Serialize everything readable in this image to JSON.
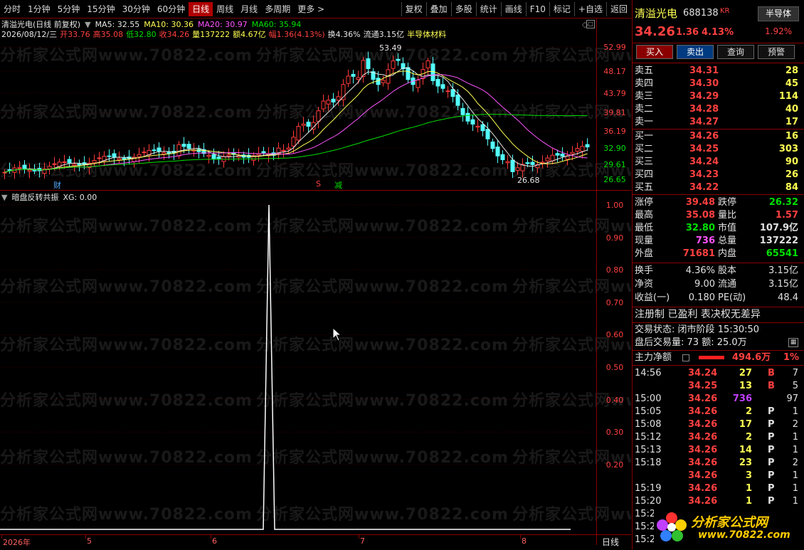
{
  "toolbar": {
    "periods": [
      "分时",
      "1分钟",
      "5分钟",
      "15分钟",
      "30分钟",
      "60分钟",
      "日线",
      "周线",
      "月线",
      "多周期",
      "更多 >"
    ],
    "active_period": "日线",
    "right_buttons": [
      "复权",
      "叠加",
      "多股",
      "统计",
      "画线",
      "F10",
      "标记",
      "+自选",
      "返回"
    ]
  },
  "chart_header": {
    "title": "清溢光电(日线 前复权)",
    "ma5": "MA5: 32.55",
    "ma10": "MA10: 30.36",
    "ma20": "MA20: 30.97",
    "ma60": "MA60: 35.94"
  },
  "info_line": {
    "date": "2026/08/12/三",
    "open": "开33.76",
    "high": "高35.08",
    "low": "低32.80",
    "close": "收34.26",
    "volume": "量137222",
    "amount": "额4.67亿",
    "amplitude": "幅1.36(4.13%)",
    "turnover": "换4.36%",
    "float": "流通3.15亿",
    "sector": "半导体材料"
  },
  "price_axis": [
    "52.99",
    "48.17",
    "43.79",
    "39.81",
    "36.19",
    "32.90",
    "29.61",
    "26.65"
  ],
  "annotations": {
    "high_mark": "53.49",
    "low_mark": "26.68",
    "tag_cai": "财",
    "tag_s": "S",
    "tag_jian": "减"
  },
  "indicator": {
    "title": "暗盘反转共振",
    "value": "XG: 0.00",
    "axis": [
      "1.00",
      "0.90",
      "0.80",
      "0.70",
      "0.60",
      "0.50",
      "0.40",
      "0.30",
      "0.20"
    ]
  },
  "x_axis": {
    "labels": [
      "2026年",
      "5",
      "6",
      "7",
      "8"
    ],
    "period_label": "日线"
  },
  "watermark": "分析家公式网www.70822.com",
  "quote": {
    "name": "清溢光电",
    "code": "688138",
    "tag": "KR",
    "sector_btn": "半导体",
    "sector_pct": "1.92%",
    "price": "34.26",
    "change": "1.36",
    "change_pct": "4.13%",
    "buttons": [
      "买入",
      "卖出",
      "查询",
      "预警"
    ]
  },
  "order_book": {
    "asks": [
      {
        "label": "卖五",
        "price": "34.31",
        "vol": "28"
      },
      {
        "label": "卖四",
        "price": "34.30",
        "vol": "45"
      },
      {
        "label": "卖三",
        "price": "34.29",
        "vol": "114"
      },
      {
        "label": "卖二",
        "price": "34.28",
        "vol": "40"
      },
      {
        "label": "卖一",
        "price": "34.27",
        "vol": "17"
      }
    ],
    "bids": [
      {
        "label": "买一",
        "price": "34.26",
        "vol": "16"
      },
      {
        "label": "买二",
        "price": "34.25",
        "vol": "303"
      },
      {
        "label": "买三",
        "price": "34.24",
        "vol": "90"
      },
      {
        "label": "买四",
        "price": "34.23",
        "vol": "26"
      },
      {
        "label": "买五",
        "price": "34.22",
        "vol": "84"
      }
    ]
  },
  "stats": [
    {
      "l1": "涨停",
      "v1": "39.48",
      "l2": "跌停",
      "v2": "26.32"
    },
    {
      "l1": "最高",
      "v1": "35.08",
      "l2": "量比",
      "v2": "1.57"
    },
    {
      "l1": "最低",
      "v1": "32.80",
      "l2": "市值",
      "v2": "107.9亿"
    },
    {
      "l1": "现量",
      "v1": "736",
      "l2": "总量",
      "v2": "137222"
    },
    {
      "l1": "外盘",
      "v1": "71681",
      "l2": "内盘",
      "v2": "65541"
    }
  ],
  "stats2": [
    {
      "l1": "换手",
      "v1": "4.36%",
      "l2": "股本",
      "v2": "3.15亿"
    },
    {
      "l1": "净资",
      "v1": "9.00",
      "l2": "流通",
      "v2": "3.15亿"
    },
    {
      "l1": "收益(一)",
      "v1": "0.180",
      "l2": "PE(动)",
      "v2": "48.4"
    }
  ],
  "status": {
    "line1": "注册制 已盈利 表决权无差异",
    "line2_label": "交易状态:",
    "line2_value": "闭市阶段",
    "line2_time": "15:30:50",
    "line3": "盘后交易量: 73",
    "line3_b": "额: 25.0万"
  },
  "main_flow": {
    "label": "主力净额",
    "value": "494.6万",
    "pct": "1%"
  },
  "ticks": [
    {
      "t": "14:56",
      "p": "34.24",
      "v": "27",
      "d": "B",
      "n": "7"
    },
    {
      "t": "",
      "p": "34.25",
      "v": "13",
      "d": "B",
      "n": "5"
    },
    {
      "t": "15:00",
      "p": "34.26",
      "v": "736",
      "d": "",
      "n": "97"
    },
    {
      "t": "15:05",
      "p": "34.26",
      "v": "2",
      "d": "P",
      "n": "1"
    },
    {
      "t": "15:08",
      "p": "34.26",
      "v": "17",
      "d": "P",
      "n": "2"
    },
    {
      "t": "15:12",
      "p": "34.26",
      "v": "2",
      "d": "P",
      "n": "1"
    },
    {
      "t": "15:13",
      "p": "34.26",
      "v": "14",
      "d": "P",
      "n": "1"
    },
    {
      "t": "15:18",
      "p": "34.26",
      "v": "23",
      "d": "P",
      "n": "2"
    },
    {
      "t": "",
      "p": "34.26",
      "v": "3",
      "d": "P",
      "n": "1"
    },
    {
      "t": "15:19",
      "p": "34.26",
      "v": "1",
      "d": "P",
      "n": "1"
    },
    {
      "t": "15:20",
      "p": "34.26",
      "v": "1",
      "d": "P",
      "n": "1"
    },
    {
      "t": "15:25",
      "p": "",
      "v": "",
      "d": "",
      "n": ""
    },
    {
      "t": "15:27",
      "p": "",
      "v": "",
      "d": "",
      "n": ""
    },
    {
      "t": "15:28",
      "p": "",
      "v": "",
      "d": "",
      "n": ""
    }
  ],
  "logo": {
    "text": "分析家公式网",
    "url": "www.70822.com"
  }
}
